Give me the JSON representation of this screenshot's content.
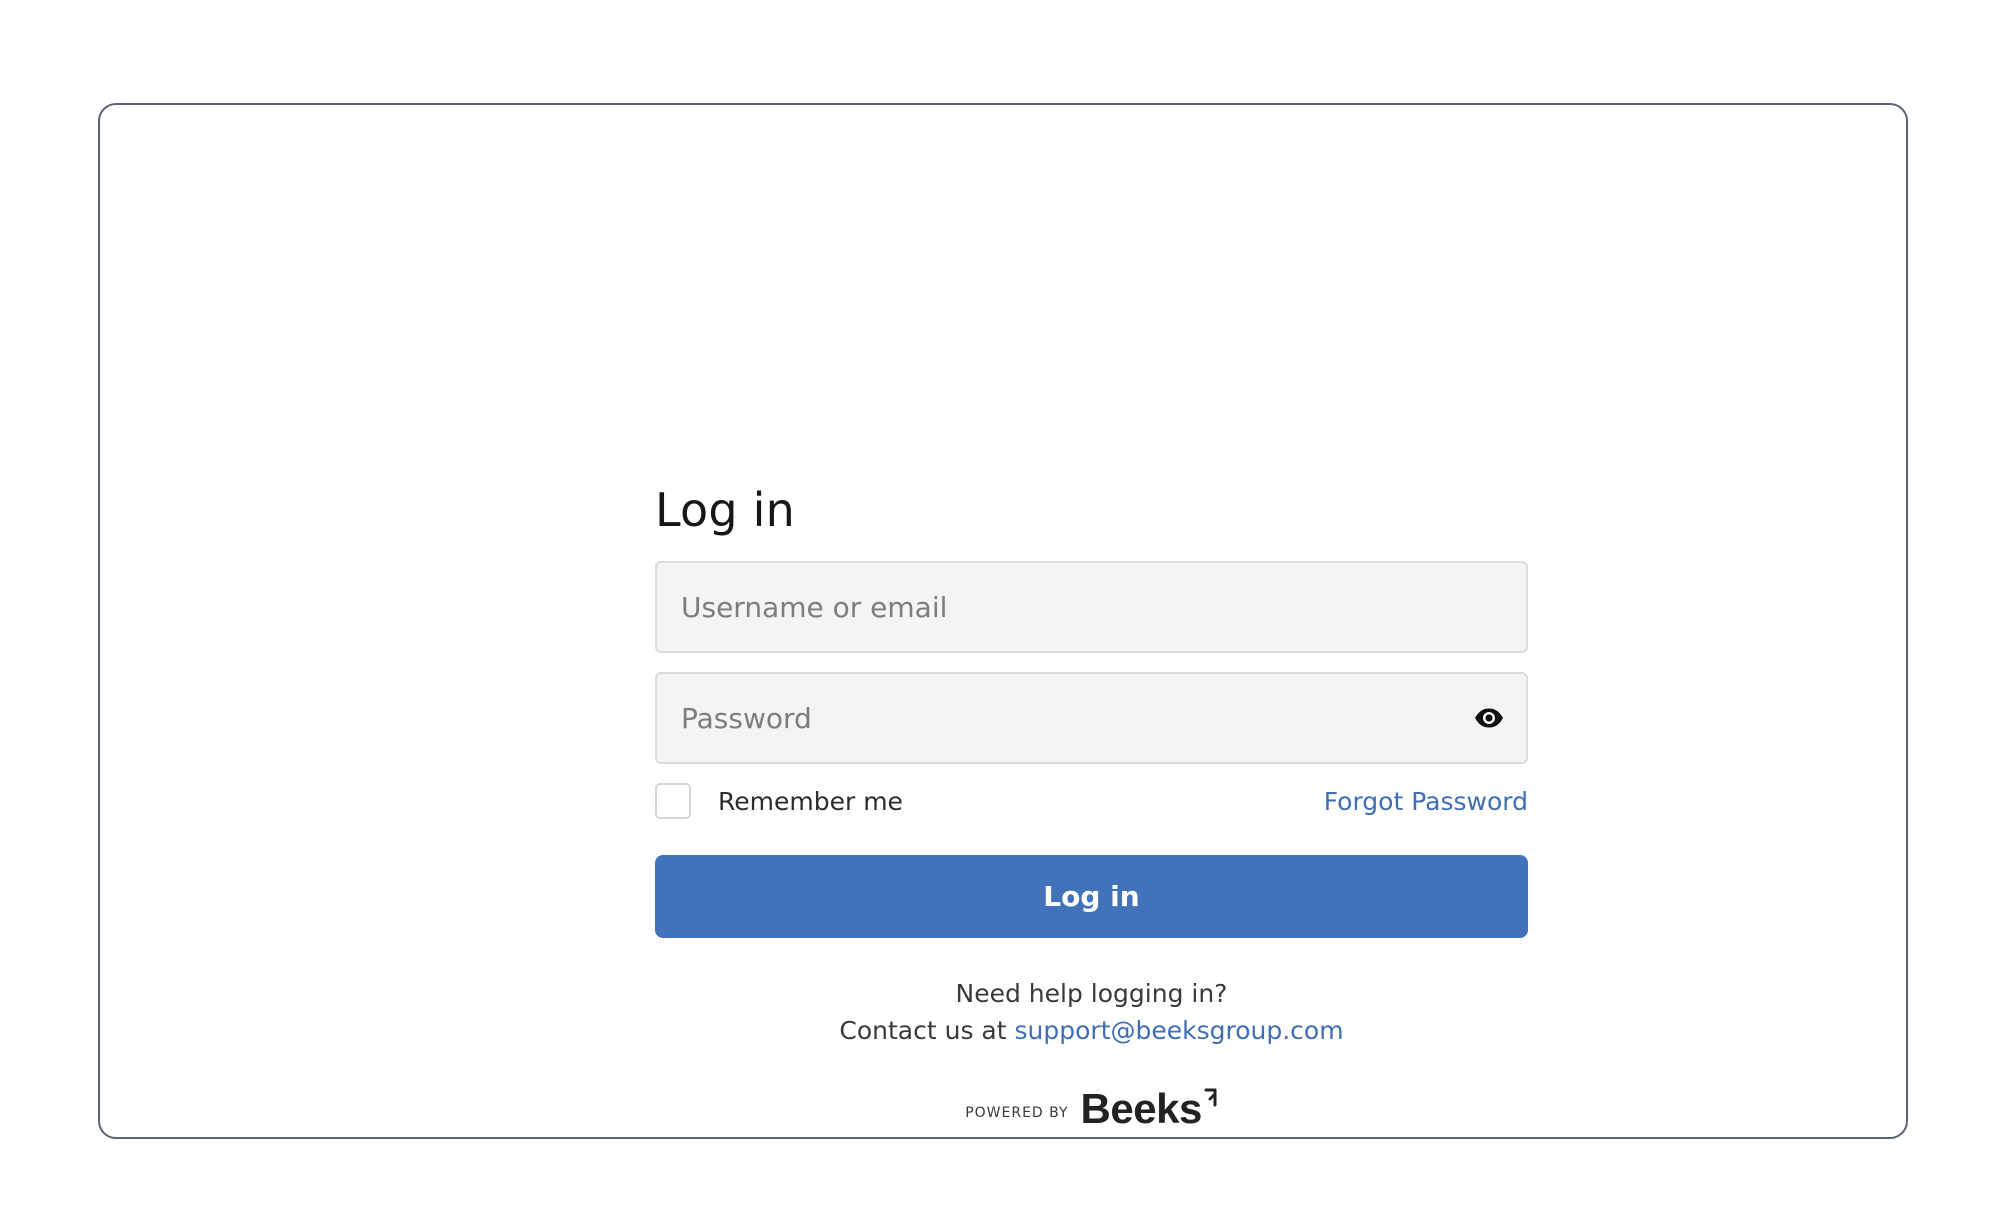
{
  "login": {
    "title": "Log in",
    "username_placeholder": "Username or email",
    "password_placeholder": "Password",
    "remember_label": "Remember me",
    "forgot_label": "Forgot Password",
    "submit_label": "Log in",
    "help_text": "Need help logging in?",
    "contact_prefix": "Contact us at ",
    "support_email": "support@beeksgroup.com",
    "powered_label": "POWERED BY",
    "brand_name": "Beeks"
  },
  "icons": {
    "password_toggle": "eye-icon",
    "brand_mark": "beeks-logo-mark"
  },
  "colors": {
    "accent": "#4272b9",
    "link": "#3f6eb4",
    "frame_border": "#5b6577",
    "field_background": "#f4f4f4"
  }
}
